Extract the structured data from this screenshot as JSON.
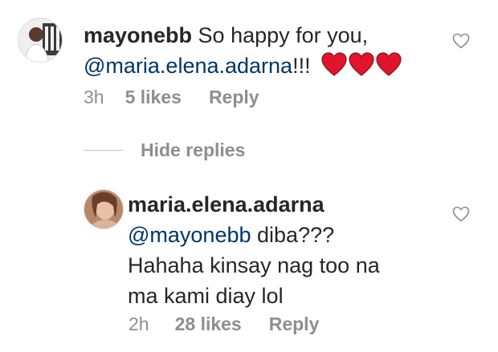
{
  "comment": {
    "username": "mayonebb",
    "text": "So happy for you,",
    "mention": "@maria.elena.adarna",
    "suffix": "!!!",
    "emoji": "heart-emoji x3",
    "time": "3h",
    "likes": "5 likes",
    "reply_label": "Reply"
  },
  "hide_replies_label": "Hide replies",
  "reply": {
    "username": "maria.elena.adarna",
    "mention": "@mayonebb",
    "text_line1": "diba???",
    "text_line2": "Hahaha kinsay nag too na",
    "text_line3": "ma kami diay lol",
    "time": "2h",
    "likes": "28 likes",
    "reply_label": "Reply"
  },
  "colors": {
    "text": "#262626",
    "muted": "#8e8e8e",
    "mention": "#003569",
    "heart": "#e0152d"
  }
}
